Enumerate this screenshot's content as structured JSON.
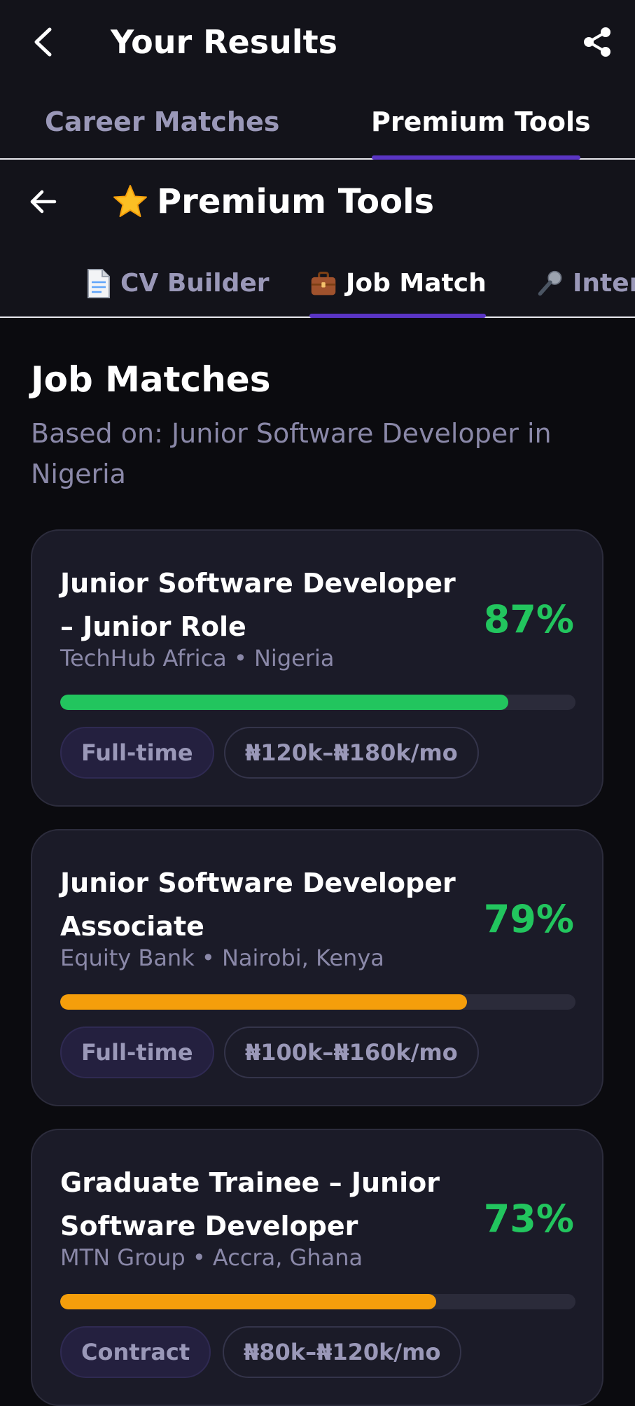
{
  "header": {
    "title": "Your Results"
  },
  "main_tabs": [
    {
      "label": "Career Matches",
      "active": false
    },
    {
      "label": "Premium Tools",
      "active": true
    }
  ],
  "premium": {
    "title": "Premium Tools",
    "tabs": [
      {
        "label": "CV Builder",
        "icon": "document-icon",
        "active": false
      },
      {
        "label": "Job Match",
        "icon": "briefcase-icon",
        "active": true
      },
      {
        "label": "Inter",
        "icon": "microphone-icon",
        "active": false
      }
    ]
  },
  "content": {
    "title": "Job Matches",
    "subtitle": "Based on: Junior Software Developer in Nigeria"
  },
  "jobs": [
    {
      "title": "Junior Software Developer – Junior Role",
      "company": "TechHub Africa • Nigeria",
      "score": "87%",
      "score_value": 87,
      "bar_color": "#22c55e",
      "type": "Full-time",
      "salary": "₦120k–₦180k/mo"
    },
    {
      "title": "Junior Software Developer Associate",
      "company": "Equity Bank • Nairobi, Kenya",
      "score": "79%",
      "score_value": 79,
      "bar_color": "#f59e0b",
      "type": "Full-time",
      "salary": "₦100k–₦160k/mo"
    },
    {
      "title": "Graduate Trainee – Junior Software Developer",
      "company": "MTN Group • Accra, Ghana",
      "score": "73%",
      "score_value": 73,
      "bar_color": "#f59e0b",
      "type": "Contract",
      "salary": "₦80k–₦120k/mo"
    }
  ],
  "colors": {
    "accent": "#5a35c4",
    "score_green": "#22c55e",
    "bar_amber": "#f59e0b"
  }
}
